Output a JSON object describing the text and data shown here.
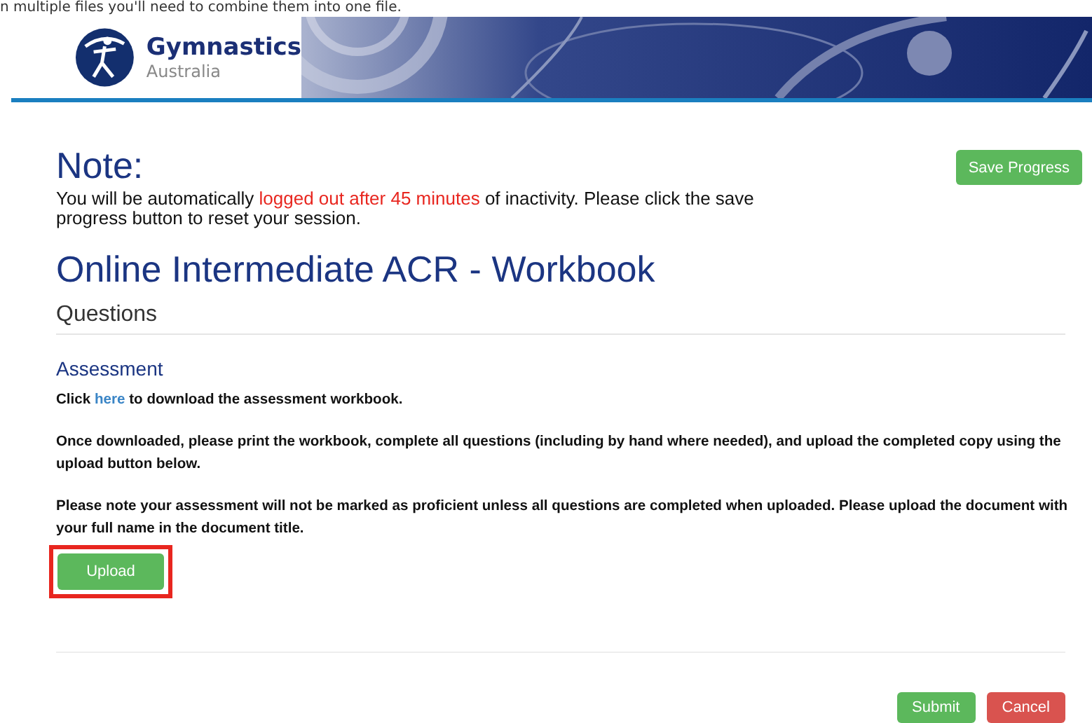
{
  "caption_fragment": "n multiple files you'll need to combine them into one file.",
  "header": {
    "brand": "Gymnastics",
    "brand_sub": "Australia"
  },
  "note": {
    "heading": "Note:",
    "before": "You will be automatically ",
    "warning": "logged out after 45 minutes",
    "after": " of inactivity. Please click the save progress button to reset your session.",
    "save_button": "Save Progress"
  },
  "title": "Online Intermediate ACR - Workbook",
  "section": "Questions",
  "assessment": {
    "heading": "Assessment",
    "download_before": "Click ",
    "download_link": "here",
    "download_after": " to download the assessment workbook.",
    "instructions": [
      "Once downloaded, please print the workbook, complete all questions (including by hand where needed), and upload the completed copy using the upload button below.",
      "Please note your assessment will not be marked as proficient unless all questions are completed when uploaded. Please upload the document with your full name in the document title."
    ],
    "upload_button": "Upload",
    "upload_highlighted": true
  },
  "buttons": [
    {
      "label": "Submit",
      "kind": "primary"
    },
    {
      "label": "Cancel",
      "kind": "danger"
    }
  ]
}
